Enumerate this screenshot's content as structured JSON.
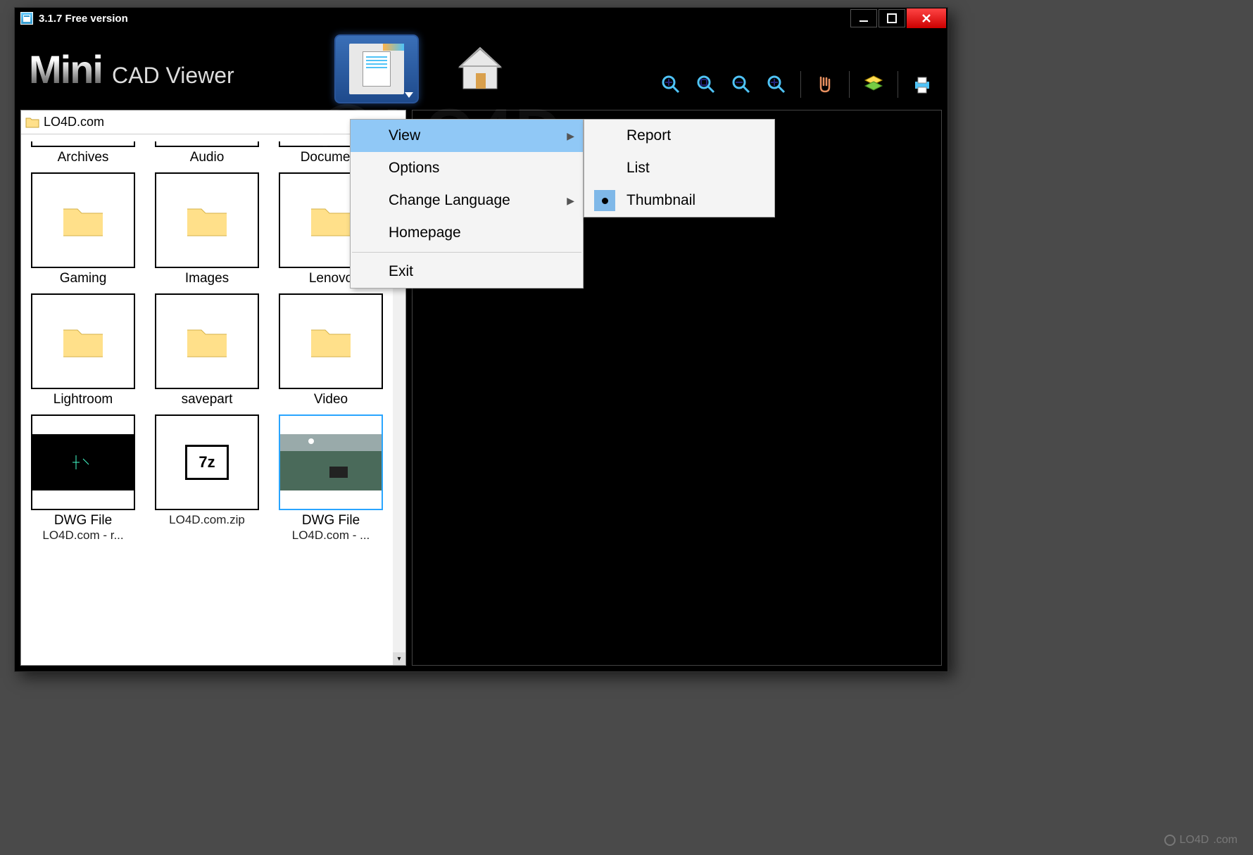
{
  "titlebar": {
    "title": "3.1.7 Free version"
  },
  "logo": {
    "main": "Mini",
    "sub": "CAD Viewer"
  },
  "toolbar_icons": [
    "zoom-fit",
    "zoom-window",
    "zoom-out",
    "zoom-in",
    "pan",
    "layers",
    "print"
  ],
  "path_bar": {
    "path": "LO4D.com"
  },
  "folders": {
    "row_partial": [
      "Archives",
      "Audio",
      "Document"
    ],
    "row1": [
      "Gaming",
      "Images",
      "Lenovo"
    ],
    "row2": [
      "Lightroom",
      "savepart",
      "Video"
    ]
  },
  "files": [
    {
      "label": "DWG File",
      "sub": "LO4D.com - r...",
      "kind": "dwg-black"
    },
    {
      "label": "",
      "sub": "LO4D.com.zip",
      "kind": "7z"
    },
    {
      "label": "DWG File",
      "sub": "LO4D.com - ...",
      "kind": "dwg-green",
      "selected": true
    }
  ],
  "menu_main": {
    "items": [
      {
        "label": "View",
        "has_sub": true,
        "highlight": true
      },
      {
        "label": "Options"
      },
      {
        "label": "Change Language",
        "has_sub": true
      },
      {
        "label": "Homepage"
      },
      {
        "sep": true
      },
      {
        "label": "Exit"
      }
    ]
  },
  "menu_sub": {
    "items": [
      {
        "label": "Report"
      },
      {
        "label": "List"
      },
      {
        "label": "Thumbnail",
        "checked": true
      }
    ]
  },
  "watermark": {
    "text": "LO4D",
    "suffix": ".com"
  }
}
